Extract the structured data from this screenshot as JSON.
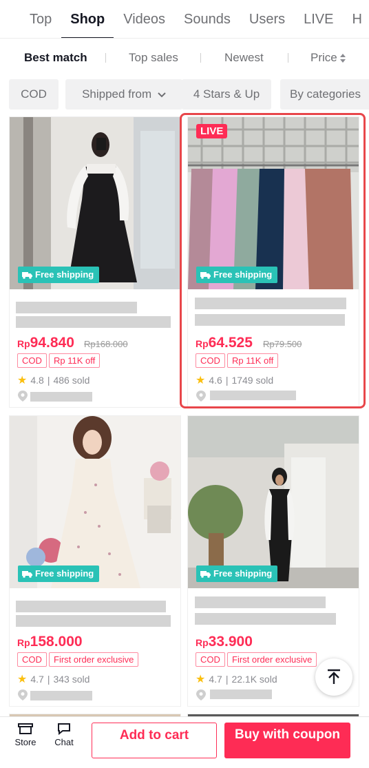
{
  "tabs": [
    "Top",
    "Shop",
    "Videos",
    "Sounds",
    "Users",
    "LIVE",
    "H"
  ],
  "active_tab": "Shop",
  "sort": {
    "best_match": "Best match",
    "top_sales": "Top sales",
    "newest": "Newest",
    "price": "Price"
  },
  "filters": {
    "cod": "COD",
    "shipped_from": "Shipped from",
    "four_stars": "4 Stars & Up",
    "by_categories": "By categories"
  },
  "products": [
    {
      "badge": "",
      "shipping": "Free shipping",
      "currency": "Rp",
      "price": "94.840",
      "original_price": "Rp168.000",
      "tags": [
        "COD",
        "Rp 11K off"
      ],
      "rating": "4.8",
      "sold": "486 sold"
    },
    {
      "badge": "LIVE",
      "shipping": "Free shipping",
      "currency": "Rp",
      "price": "64.525",
      "original_price": "Rp79.500",
      "tags": [
        "COD",
        "Rp 11K off"
      ],
      "rating": "4.6",
      "sold": "1749 sold"
    },
    {
      "badge": "",
      "shipping": "Free shipping",
      "currency": "Rp",
      "price": "158.000",
      "original_price": "",
      "tags": [
        "COD",
        "First order exclusive"
      ],
      "rating": "4.7",
      "sold": "343 sold"
    },
    {
      "badge": "",
      "shipping": "Free shipping",
      "currency": "Rp",
      "price": "33.900",
      "original_price": "",
      "tags": [
        "COD",
        "First order exclusive"
      ],
      "rating": "4.7",
      "sold": "22.1K sold"
    }
  ],
  "bottom_bar": {
    "store": "Store",
    "chat": "Chat",
    "add_to_cart": "Add to cart",
    "buy_with_coupon": "Buy with coupon"
  },
  "colors": {
    "accent": "#fe2c55",
    "shipping": "#2ac2b6",
    "highlight": "#e8464a"
  }
}
